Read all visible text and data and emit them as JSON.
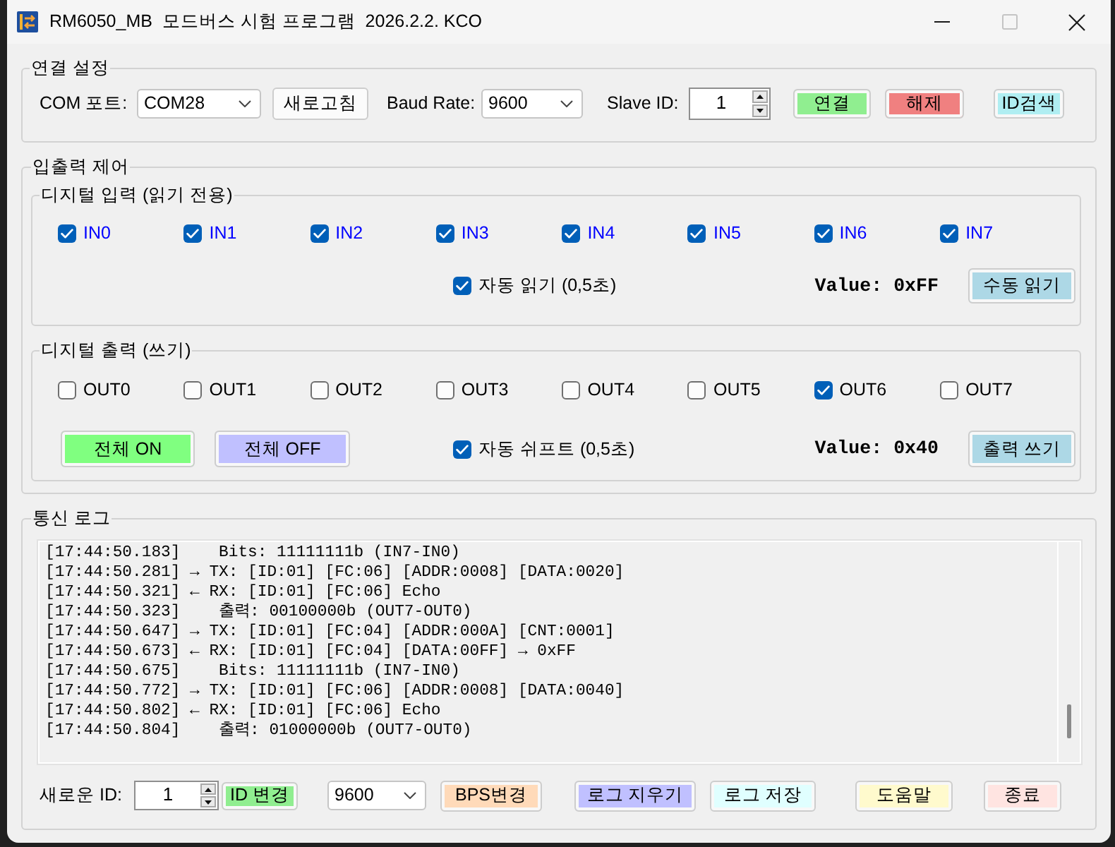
{
  "window": {
    "title": "RM6050_MB  모드버스 시험 프로그램  2026.2.2. KCO",
    "controls": [
      {
        "kind": "minimize",
        "disabled": false
      },
      {
        "kind": "maximize",
        "disabled": true
      },
      {
        "kind": "close",
        "disabled": false
      }
    ]
  },
  "connection": {
    "title": "연결 설정",
    "com_port": {
      "label": "COM 포트:",
      "value": "COM28"
    },
    "refresh_button": "새로고침",
    "baud_rate": {
      "label": "Baud Rate:",
      "value": "9600"
    },
    "slave_id": {
      "label": "Slave ID:",
      "value": "1"
    },
    "buttons": [
      {
        "label": "연결",
        "color": "#90ee90"
      },
      {
        "label": "해제",
        "color": "#f08080"
      },
      {
        "label": "ID검색",
        "color": "#b0eef2"
      }
    ]
  },
  "io_control": {
    "title": "입출력 제어",
    "digital_input": {
      "title": "디지털 입력 (읽기 전용)",
      "channels": [
        {
          "label": "IN0",
          "checked": true
        },
        {
          "label": "IN1",
          "checked": true
        },
        {
          "label": "IN2",
          "checked": true
        },
        {
          "label": "IN3",
          "checked": true
        },
        {
          "label": "IN4",
          "checked": true
        },
        {
          "label": "IN5",
          "checked": true
        },
        {
          "label": "IN6",
          "checked": true
        },
        {
          "label": "IN7",
          "checked": true
        }
      ],
      "auto_read": {
        "label": "자동 읽기 (0,5초)",
        "checked": true
      },
      "value": "Value: 0xFF",
      "button": {
        "label": "수동 읽기",
        "color": "#add8e6"
      }
    },
    "digital_output": {
      "title": "디지털 출력 (쓰기)",
      "channels": [
        {
          "label": "OUT0",
          "checked": false
        },
        {
          "label": "OUT1",
          "checked": false
        },
        {
          "label": "OUT2",
          "checked": false
        },
        {
          "label": "OUT3",
          "checked": false
        },
        {
          "label": "OUT4",
          "checked": false
        },
        {
          "label": "OUT5",
          "checked": false
        },
        {
          "label": "OUT6",
          "checked": true
        },
        {
          "label": "OUT7",
          "checked": false
        }
      ],
      "buttons": [
        {
          "label": "전체 ON",
          "color": "#80ff80"
        },
        {
          "label": "전체 OFF",
          "color": "#c0c0ff"
        }
      ],
      "auto_shift": {
        "label": "자동 쉬프트 (0,5초)",
        "checked": true
      },
      "value": "Value: 0x40",
      "button": {
        "label": "출력 쓰기",
        "color": "#add8e6"
      }
    }
  },
  "log": {
    "title": "통신 로그",
    "lines": [
      "[17:44:50.183]    Bits: 11111111b (IN7-IN0)",
      "[17:44:50.281] → TX: [ID:01] [FC:06] [ADDR:0008] [DATA:0020]",
      "[17:44:50.321] ← RX: [ID:01] [FC:06] Echo",
      "[17:44:50.323]    출력: 00100000b (OUT7-OUT0)",
      "[17:44:50.647] → TX: [ID:01] [FC:04] [ADDR:000A] [CNT:0001]",
      "[17:44:50.673] ← RX: [ID:01] [FC:04] [DATA:00FF] → 0xFF",
      "[17:44:50.675]    Bits: 11111111b (IN7-IN0)",
      "[17:44:50.772] → TX: [ID:01] [FC:06] [ADDR:0008] [DATA:0040]",
      "[17:44:50.802] ← RX: [ID:01] [FC:06] Echo",
      "[17:44:50.804]    출력: 01000000b (OUT7-OUT0)"
    ]
  },
  "bottom_bar": {
    "new_id": {
      "label": "새로운 ID:",
      "value": "1"
    },
    "id_change_button": {
      "label": "ID 변경",
      "color": "#90ee90"
    },
    "baud_rate": {
      "value": "9600"
    },
    "buttons": [
      {
        "label": "BPS변경",
        "color": "#ffdab9"
      },
      {
        "label": "로그 지우기",
        "color": "#c0c0ff"
      },
      {
        "label": "로그 저장",
        "color": "#e0ffff"
      },
      {
        "label": "도움말",
        "color": "#fffacd"
      },
      {
        "label": "종료",
        "color": "#ffe4e1"
      }
    ]
  }
}
